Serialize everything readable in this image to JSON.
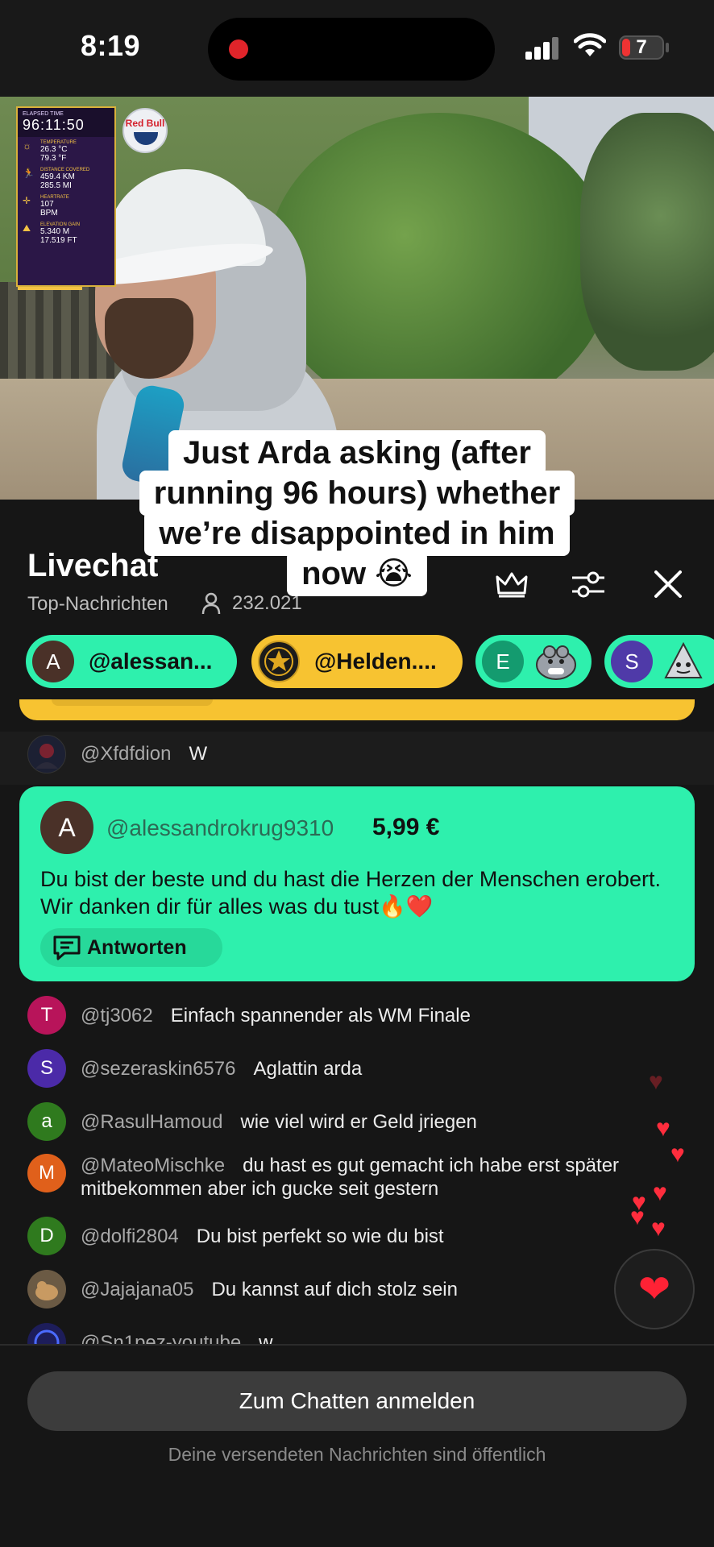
{
  "status_bar": {
    "time": "8:19",
    "battery": "7",
    "recording_color": "#e0242a"
  },
  "video": {
    "hud": {
      "elapsed_label": "ELAPSED TIME",
      "elapsed_value": "96:11:50",
      "temperature_label": "TEMPERATURE",
      "temperature_c": "26.3 °C",
      "temperature_f": "79.3 °F",
      "distance_label": "DISTANCE COVERED",
      "distance_km": "459.4 KM",
      "distance_mi": "285.5 MI",
      "heartrate_label": "HEARTRATE",
      "heartrate_value": "107",
      "heartrate_unit": "BPM",
      "elevation_label": "ELEVATION GAIN",
      "elevation_m": "5.340 M",
      "elevation_ft": "17.519 FT"
    },
    "logo_text": "Red Bull"
  },
  "caption": {
    "line1": "Just Arda asking (after",
    "line2": "running 96 hours) whether",
    "line3": "we’re disappointed in him",
    "line4": "now 😭"
  },
  "chat_header": {
    "title": "Livechat",
    "filter_label": "Top-Nachrichten",
    "viewer_count": "232.021",
    "icons": [
      "crown-icon",
      "sliders-icon",
      "close-icon"
    ]
  },
  "pinned_chips": [
    {
      "initial": "A",
      "name": "@alessan...",
      "bg": "#2ef0ad",
      "avatar_bg": "#4a3128"
    },
    {
      "initial": "",
      "name": "@Helden....",
      "bg": "#f7c331",
      "avatar_bg": "#1b1b1b"
    },
    {
      "initial": "E",
      "name": "",
      "bg": "#2ef0ad",
      "avatar_bg": "#149b6f"
    },
    {
      "initial": "S",
      "name": "",
      "bg": "#2ef0ad",
      "avatar_bg": "#4f3aa8"
    }
  ],
  "messages_top": [
    {
      "user": "@Xfdfdion",
      "text": "W"
    }
  ],
  "superchat": {
    "initial": "A",
    "user": "@alessandrokrug9310",
    "amount": "5,99 €",
    "text": "Du bist der beste und du hast die Herzen der Menschen erobert. Wir danken dir für alles was du tust🔥❤️",
    "reply_label": "Antworten"
  },
  "messages": [
    {
      "initial": "T",
      "avatar_bg": "#b8145a",
      "user": "@tj3062",
      "text": "Einfach spannender als WM Finale"
    },
    {
      "initial": "S",
      "avatar_bg": "#4b2aa8",
      "user": "@sezeraskin6576",
      "text": "Aglattin arda"
    },
    {
      "initial": "a",
      "avatar_bg": "#2f7a1e",
      "user": "@RasulHamoud",
      "text": "wie viel wird er Geld jriegen"
    },
    {
      "initial": "M",
      "avatar_bg": "#e0601b",
      "user": "@MateoMischke",
      "text": "du hast es gut gemacht ich habe erst später mitbekommen aber ich gucke seit gestern"
    },
    {
      "initial": "D",
      "avatar_bg": "#2f7a1e",
      "user": "@dolfi2804",
      "text": "Du bist perfekt so wie du bist"
    },
    {
      "initial": "",
      "avatar_bg": "#6b5a44",
      "user": "@Jajajana05",
      "text": "Du kannst auf dich stolz sein"
    },
    {
      "initial": "",
      "avatar_bg": "#1d1d5a",
      "user": "@Sn1pez-youtube",
      "text": "w"
    }
  ],
  "bottom": {
    "login_label": "Zum Chatten anmelden",
    "public_note": "Deine versendeten Nachrichten sind öffentlich"
  }
}
